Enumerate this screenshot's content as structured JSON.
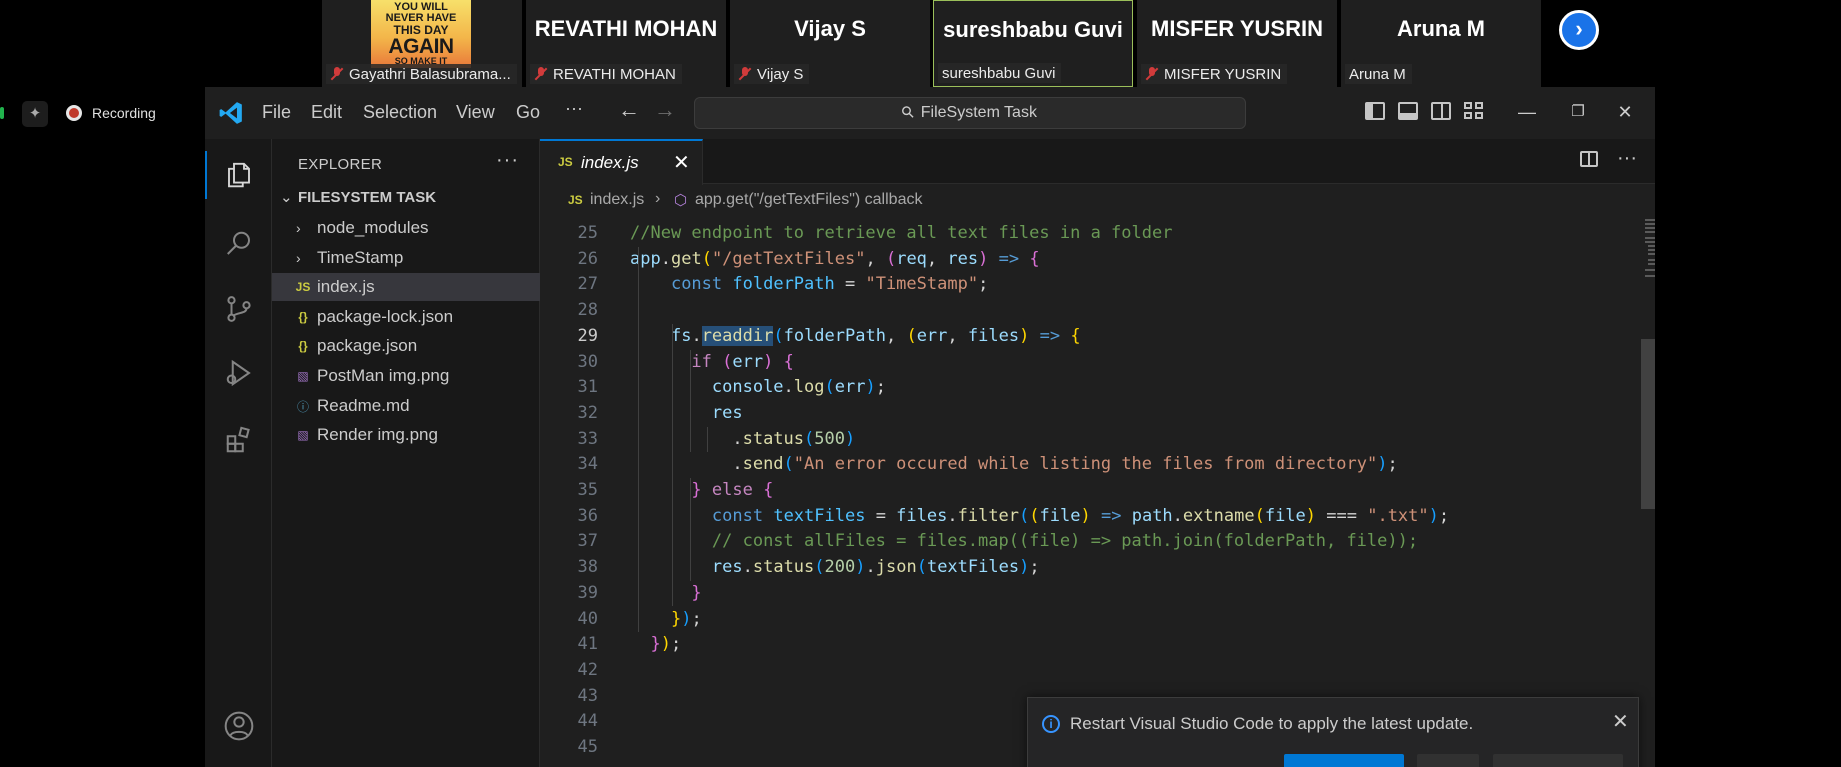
{
  "meeting": {
    "participants": [
      {
        "display": "",
        "label": "Gayathri Balasubrama...",
        "muted": true
      },
      {
        "display": "REVATHI MOHAN",
        "label": "REVATHI MOHAN",
        "muted": true
      },
      {
        "display": "Vijay S",
        "label": "Vijay S",
        "muted": true
      },
      {
        "display": "sureshbabu Guvi",
        "label": "sureshbabu Guvi",
        "muted": false
      },
      {
        "display": "MISFER YUSRIN",
        "label": "MISFER YUSRIN",
        "muted": true
      },
      {
        "display": "Aruna M",
        "label": "Aruna M",
        "muted": false
      }
    ],
    "poster_lines": [
      "YOU WILL",
      "NEVER HAVE",
      "THIS DAY",
      "AGAIN",
      "SO MAKE IT"
    ],
    "next_glyph": "›"
  },
  "recorder": {
    "label": "Recording",
    "spark_glyph": "✦"
  },
  "vscode": {
    "menu": [
      "File",
      "Edit",
      "Selection",
      "View",
      "Go",
      "···"
    ],
    "search": {
      "text": "FileSystem Task"
    },
    "window_controls": {
      "minimize": "—",
      "restore": "❐",
      "close": "✕"
    },
    "explorer": {
      "title": "EXPLORER",
      "more": "···",
      "folder": "FILESYSTEM TASK",
      "items": [
        {
          "label": "node_modules",
          "type": "folder",
          "icon": "chevron-right-icon"
        },
        {
          "label": "TimeStamp",
          "type": "folder",
          "icon": "chevron-right-icon"
        },
        {
          "label": "index.js",
          "type": "js",
          "icon": "JS",
          "selected": true
        },
        {
          "label": "package-lock.json",
          "type": "json",
          "icon": "{}"
        },
        {
          "label": "package.json",
          "type": "json",
          "icon": "{}"
        },
        {
          "label": "PostMan img.png",
          "type": "png",
          "icon": "image-icon"
        },
        {
          "label": "Readme.md",
          "type": "md",
          "icon": "ⓘ"
        },
        {
          "label": "Render img.png",
          "type": "png",
          "icon": "image-icon"
        }
      ]
    },
    "tab": {
      "badge": "JS",
      "label": "index.js",
      "close": "✕"
    },
    "breadcrumb": {
      "badge": "JS",
      "file": "index.js",
      "separator": "›",
      "symbol": "app.get(\"/getTextFiles\") callback"
    },
    "current_line": 29,
    "code": [
      {
        "n": 25,
        "tokens": [
          [
            "c-cm",
            "//New endpoint to retrieve all text files in a folder"
          ]
        ]
      },
      {
        "n": 26,
        "tokens": [
          [
            "c-var",
            "app"
          ],
          [
            "c-pl",
            "."
          ],
          [
            "c-fn",
            "get"
          ],
          [
            "c-b1",
            "("
          ],
          [
            "c-str",
            "\"/getTextFiles\""
          ],
          [
            "c-pl",
            ", "
          ],
          [
            "c-b2",
            "("
          ],
          [
            "c-var",
            "req"
          ],
          [
            "c-pl",
            ", "
          ],
          [
            "c-var",
            "res"
          ],
          [
            "c-b2",
            ")"
          ],
          [
            "c-pl",
            " "
          ],
          [
            "c-kw",
            "=>"
          ],
          [
            "c-pl",
            " "
          ],
          [
            "c-b2",
            "{"
          ]
        ]
      },
      {
        "n": 27,
        "tokens": [
          [
            "c-pl",
            "    "
          ],
          [
            "c-kw",
            "const"
          ],
          [
            "c-pl",
            " "
          ],
          [
            "c-cst",
            "folderPath"
          ],
          [
            "c-pl",
            " = "
          ],
          [
            "c-str",
            "\"TimeStamp\""
          ],
          [
            "c-pl",
            ";"
          ]
        ]
      },
      {
        "n": 28,
        "tokens": []
      },
      {
        "n": 29,
        "tokens": [
          [
            "c-pl",
            "    "
          ],
          [
            "c-var",
            "fs"
          ],
          [
            "c-pl",
            "."
          ],
          [
            "c-fn hl",
            "readdir"
          ],
          [
            "c-b3",
            "("
          ],
          [
            "c-var",
            "folderPath"
          ],
          [
            "c-pl",
            ", "
          ],
          [
            "c-b1",
            "("
          ],
          [
            "c-var",
            "err"
          ],
          [
            "c-pl",
            ", "
          ],
          [
            "c-var",
            "files"
          ],
          [
            "c-b1",
            ")"
          ],
          [
            "c-pl",
            " "
          ],
          [
            "c-kw",
            "=>"
          ],
          [
            "c-pl",
            " "
          ],
          [
            "c-b1",
            "{"
          ]
        ]
      },
      {
        "n": 30,
        "tokens": [
          [
            "c-pl",
            "      "
          ],
          [
            "c-ctl",
            "if"
          ],
          [
            "c-pl",
            " "
          ],
          [
            "c-b2",
            "("
          ],
          [
            "c-var",
            "err"
          ],
          [
            "c-b2",
            ")"
          ],
          [
            "c-pl",
            " "
          ],
          [
            "c-b2",
            "{"
          ]
        ]
      },
      {
        "n": 31,
        "tokens": [
          [
            "c-pl",
            "        "
          ],
          [
            "c-var",
            "console"
          ],
          [
            "c-pl",
            "."
          ],
          [
            "c-fn",
            "log"
          ],
          [
            "c-b3",
            "("
          ],
          [
            "c-var",
            "err"
          ],
          [
            "c-b3",
            ")"
          ],
          [
            "c-pl",
            ";"
          ]
        ]
      },
      {
        "n": 32,
        "tokens": [
          [
            "c-pl",
            "        "
          ],
          [
            "c-var",
            "res"
          ]
        ]
      },
      {
        "n": 33,
        "tokens": [
          [
            "c-pl",
            "          ."
          ],
          [
            "c-fn",
            "status"
          ],
          [
            "c-b3",
            "("
          ],
          [
            "c-num",
            "500"
          ],
          [
            "c-b3",
            ")"
          ]
        ]
      },
      {
        "n": 34,
        "tokens": [
          [
            "c-pl",
            "          ."
          ],
          [
            "c-fn",
            "send"
          ],
          [
            "c-b3",
            "("
          ],
          [
            "c-str",
            "\"An error occured while listing the files from directory\""
          ],
          [
            "c-b3",
            ")"
          ],
          [
            "c-pl",
            ";"
          ]
        ]
      },
      {
        "n": 35,
        "tokens": [
          [
            "c-pl",
            "      "
          ],
          [
            "c-b2",
            "}"
          ],
          [
            "c-pl",
            " "
          ],
          [
            "c-ctl",
            "else"
          ],
          [
            "c-pl",
            " "
          ],
          [
            "c-b2",
            "{"
          ]
        ]
      },
      {
        "n": 36,
        "tokens": [
          [
            "c-pl",
            "        "
          ],
          [
            "c-kw",
            "const"
          ],
          [
            "c-pl",
            " "
          ],
          [
            "c-cst",
            "textFiles"
          ],
          [
            "c-pl",
            " = "
          ],
          [
            "c-var",
            "files"
          ],
          [
            "c-pl",
            "."
          ],
          [
            "c-fn",
            "filter"
          ],
          [
            "c-b3",
            "("
          ],
          [
            "c-b1",
            "("
          ],
          [
            "c-var",
            "file"
          ],
          [
            "c-b1",
            ")"
          ],
          [
            "c-pl",
            " "
          ],
          [
            "c-kw",
            "=>"
          ],
          [
            "c-pl",
            " "
          ],
          [
            "c-var",
            "path"
          ],
          [
            "c-pl",
            "."
          ],
          [
            "c-fn",
            "extname"
          ],
          [
            "c-b1",
            "("
          ],
          [
            "c-var",
            "file"
          ],
          [
            "c-b1",
            ")"
          ],
          [
            "c-pl",
            " === "
          ],
          [
            "c-str",
            "\".txt\""
          ],
          [
            "c-b3",
            ")"
          ],
          [
            "c-pl",
            ";"
          ]
        ]
      },
      {
        "n": 37,
        "tokens": [
          [
            "c-pl",
            "        "
          ],
          [
            "c-cm",
            "// const allFiles = files.map((file) => path.join(folderPath, file));"
          ]
        ]
      },
      {
        "n": 38,
        "tokens": [
          [
            "c-pl",
            "        "
          ],
          [
            "c-var",
            "res"
          ],
          [
            "c-pl",
            "."
          ],
          [
            "c-fn",
            "status"
          ],
          [
            "c-b3",
            "("
          ],
          [
            "c-num",
            "200"
          ],
          [
            "c-b3",
            ")"
          ],
          [
            "c-pl",
            "."
          ],
          [
            "c-fn",
            "json"
          ],
          [
            "c-b3",
            "("
          ],
          [
            "c-var",
            "textFiles"
          ],
          [
            "c-b3",
            ")"
          ],
          [
            "c-pl",
            ";"
          ]
        ]
      },
      {
        "n": 39,
        "tokens": [
          [
            "c-pl",
            "      "
          ],
          [
            "c-b2",
            "}"
          ]
        ]
      },
      {
        "n": 40,
        "tokens": [
          [
            "c-pl",
            "    "
          ],
          [
            "c-b1",
            "}"
          ],
          [
            "c-b3",
            ")"
          ],
          [
            "c-pl",
            ";"
          ]
        ]
      },
      {
        "n": 41,
        "tokens": [
          [
            "c-pl",
            "  "
          ],
          [
            "c-b2",
            "}"
          ],
          [
            "c-b1",
            ")"
          ],
          [
            "c-pl",
            ";"
          ]
        ]
      },
      {
        "n": 42,
        "tokens": []
      },
      {
        "n": 43,
        "tokens": []
      },
      {
        "n": 44,
        "tokens": []
      },
      {
        "n": 45,
        "tokens": []
      }
    ],
    "notification": {
      "message": "Restart Visual Studio Code to apply the latest update.",
      "close": "✕"
    }
  },
  "colors": {
    "accent": "#0078d4",
    "recording": "#c0392b",
    "meet_button": "#1a73e8",
    "muted_mic": "#d13b3b"
  }
}
